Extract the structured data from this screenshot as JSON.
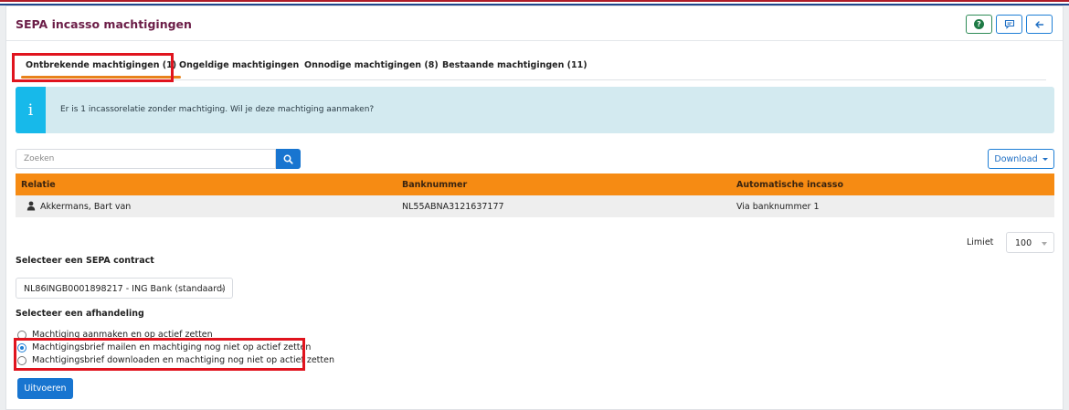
{
  "page": {
    "title": "SEPA incasso machtigingen",
    "colors": {
      "title": "#6b1d47",
      "accent_orange": "#f68b13",
      "primary_blue": "#1875d0",
      "info_blue": "#17b9ea",
      "highlight_red": "#e0141e"
    }
  },
  "header": {
    "help_icon": "question-circle-icon",
    "feedback_icon": "feedback-chat-icon",
    "back_icon": "arrow-left-icon"
  },
  "tabs": [
    {
      "label": "Ontbrekende machtigingen (1)",
      "active": true
    },
    {
      "label": "Ongeldige machtigingen",
      "active": false
    },
    {
      "label": "Onnodige machtigingen (8)",
      "active": false
    },
    {
      "label": "Bestaande machtigingen (11)",
      "active": false
    }
  ],
  "alert": {
    "icon": "i",
    "text": "Er is 1 incassorelatie zonder machtiging. Wil je deze machtiging aanmaken?"
  },
  "search": {
    "placeholder": "Zoeken",
    "value": ""
  },
  "download": {
    "label": "Download"
  },
  "table": {
    "columns": [
      "Relatie",
      "Banknummer",
      "Automatische incasso"
    ],
    "rows": [
      {
        "relatie": "Akkermans, Bart van",
        "banknummer": "NL55ABNA3121637177",
        "incasso": "Via banknummer 1"
      }
    ]
  },
  "limit": {
    "label": "Limiet",
    "value": "100"
  },
  "contract": {
    "label": "Selecteer een SEPA contract",
    "selected": "NL86INGB0001898217 - ING Bank (standaard)"
  },
  "handling": {
    "label": "Selecteer een afhandeling",
    "options": [
      {
        "label": "Machtiging aanmaken en op actief zetten",
        "checked": false
      },
      {
        "label": "Machtigingsbrief mailen en machtiging nog niet op actief zetten",
        "checked": true
      },
      {
        "label": "Machtigingsbrief downloaden en machtiging nog niet op actief zetten",
        "checked": false
      }
    ]
  },
  "submit": {
    "label": "Uitvoeren"
  }
}
